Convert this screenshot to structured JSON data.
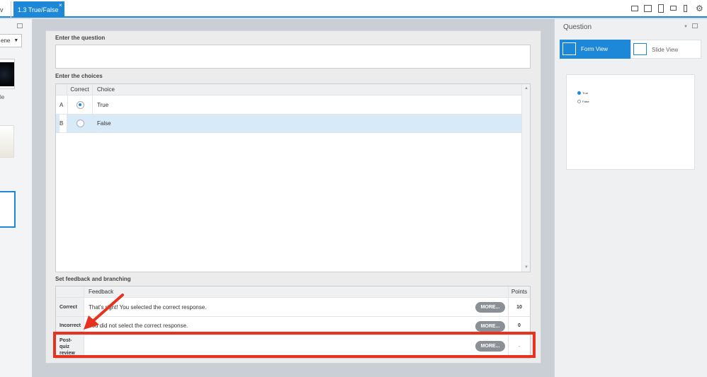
{
  "tabs": {
    "previous": "v",
    "active": "1.3 True/False",
    "close": "×"
  },
  "toolbar_icons": [
    "desktop-icon",
    "tablet-landscape-icon",
    "tablet-portrait-icon",
    "phone-landscape-icon",
    "phone-portrait-icon",
    "gear-icon"
  ],
  "left_panel": {
    "dropdown_value": "ene",
    "thumb_caption": "le"
  },
  "question": {
    "label": "Enter the question",
    "value": ""
  },
  "choices": {
    "label": "Enter the choices",
    "columns": [
      "Correct",
      "Choice"
    ],
    "rows": [
      {
        "letter": "A",
        "text": "True",
        "selected": true
      },
      {
        "letter": "B",
        "text": "False",
        "selected": false
      }
    ]
  },
  "feedback": {
    "label": "Set feedback and branching",
    "columns": [
      "Feedback",
      "Points"
    ],
    "rows": [
      {
        "name": "Correct",
        "text": "That's right!  You selected the correct response.",
        "button": "MORE...",
        "points": "10"
      },
      {
        "name": "Incorrect",
        "text": "You did not select the correct response.",
        "button": "MORE...",
        "points": "0"
      },
      {
        "name": "Post-quiz review",
        "text": "",
        "button": "MORE...",
        "points": "-"
      }
    ]
  },
  "right_panel": {
    "title": "Question",
    "form_view": "Form View",
    "slide_view": "Slide View",
    "preview_options": [
      "True",
      "False"
    ]
  },
  "colors": {
    "accent": "#1e88d8",
    "highlight": "#e8321f"
  }
}
